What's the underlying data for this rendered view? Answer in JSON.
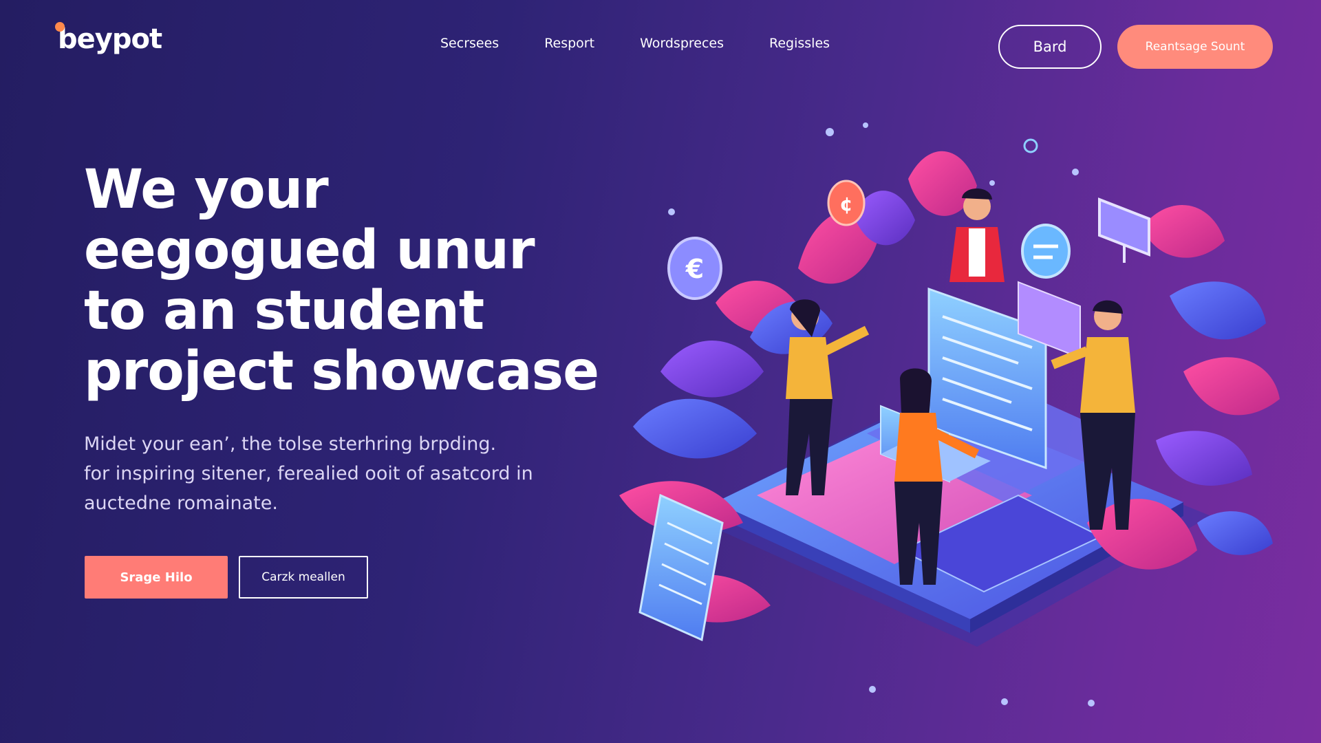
{
  "header": {
    "logo_text": "beypot",
    "nav": [
      "Secrsees",
      "Resport",
      "Wordspreces",
      "Regissles"
    ],
    "outline_button_label": "Bard",
    "cta_button_label": "Reantsage Sount"
  },
  "hero": {
    "title_lines": [
      "We your",
      "eegogued unur",
      "to an student",
      "project showcase"
    ],
    "subtitle_lines": [
      "Midet your ean’, the tolse sterhring brpding.",
      "for inspiring sitener, ferealied ooit of asatcord in",
      "auctedne romainate."
    ],
    "primary_button_label": "Srage Hilo",
    "secondary_button_label": "Carzk meallen"
  },
  "colors": {
    "background_start": "#241d62",
    "background_end": "#7a2da0",
    "accent_coral": "#ff7c76",
    "accent_peach": "#ff8b7c"
  },
  "illustration": {
    "icons": [
      "euro-coin-icon",
      "cent-coin-icon",
      "chat-bubble-icon",
      "monitor-icon"
    ]
  }
}
